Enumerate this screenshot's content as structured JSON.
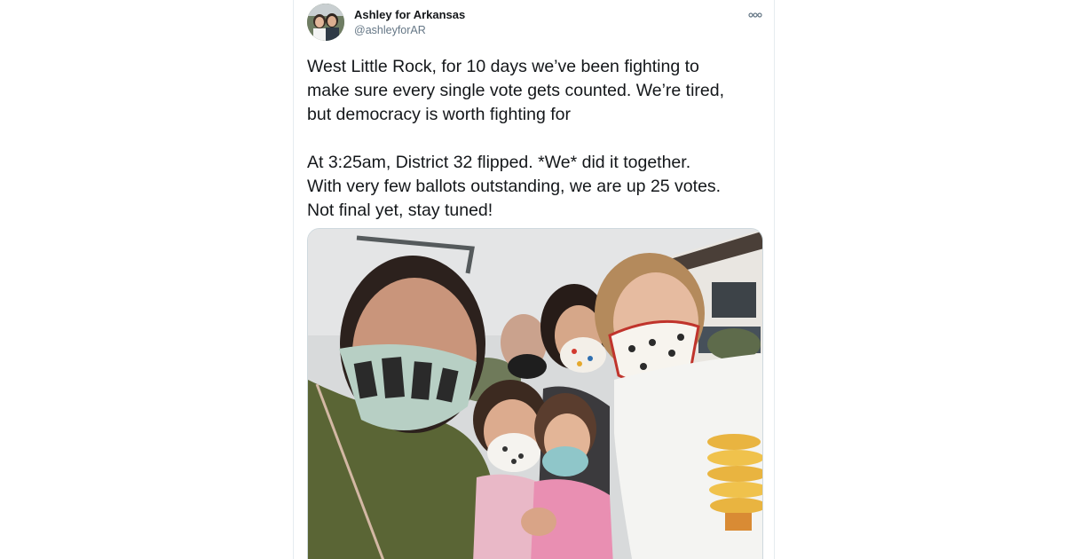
{
  "tweet": {
    "author_name": "Ashley for Arkansas",
    "author_handle": "@ashleyforAR",
    "avatar_icon": "profile-photo",
    "more_icon": "more-options-icon",
    "paragraph_1": "West Little Rock, for 10 days we’ve been fighting to\nmake sure every single vote gets counted. We’re tired,\nbut democracy is worth fighting for",
    "paragraph_2": "At 3:25am, District 32 flipped. *We* did it together.\nWith very few ballots outstanding, we are up 25 votes.\nNot final yet, stay tuned!",
    "photo_icon": "family-selfie-photo"
  },
  "colors": {
    "text": "#14171a",
    "secondary": "#657786",
    "border": "#e6ecf0"
  }
}
